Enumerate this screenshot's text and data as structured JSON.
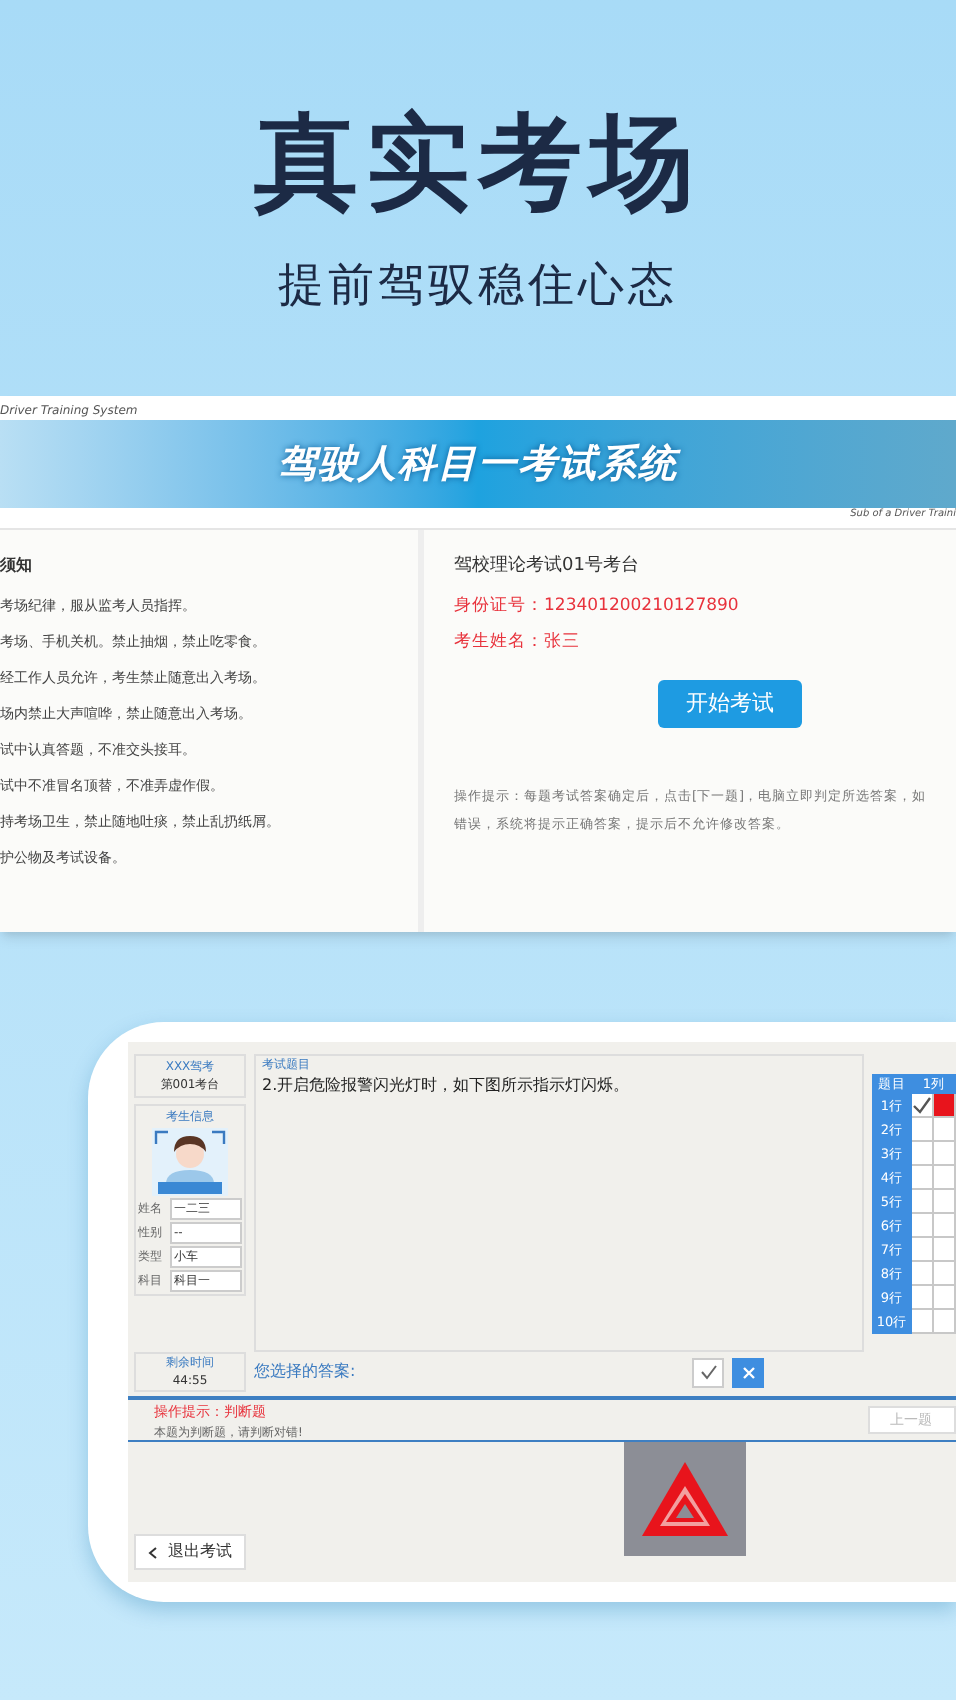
{
  "headline": {
    "title": "真实考场",
    "subtitle": "提前驾驭稳住心态"
  },
  "login_screen": {
    "top_caption": "Driver Training System",
    "banner_title": "驾驶人科目一考试系统",
    "banner_caption": "Sub of a Driver Traini",
    "notice": {
      "title": "须知",
      "lines": [
        "考场纪律，服从监考人员指挥。",
        "考场、手机关机。禁止抽烟，禁止吃零食。",
        "经工作人员允许，考生禁止随意出入考场。",
        "场内禁止大声喧哗，禁止随意出入考场。",
        "试中认真答题，不准交头接耳。",
        "试中不准冒名顶替，不准弄虚作假。",
        "持考场卫生，禁止随地吐痰，禁止乱扔纸屑。",
        "护公物及考试设备。"
      ]
    },
    "station": "驾校理论考试01号考台",
    "id_line": "身份证号：123401200210127890",
    "name_line": "考生姓名：张三",
    "start_button": "开始考试",
    "hint": "操作提示：每题考试答案确定后，点击[下一题]，电脑立即判定所选答案，如",
    "hint_line2": "错误，系统将提示正确答案，提示后不允许修改答案。"
  },
  "exam_screen": {
    "school": "XXX驾考",
    "seat": "第001考台",
    "info_title": "考生信息",
    "fields": [
      {
        "label": "姓名",
        "value": "一二三"
      },
      {
        "label": "性别",
        "value": "--"
      },
      {
        "label": "类型",
        "value": "小车"
      },
      {
        "label": "科目",
        "value": "科目一"
      }
    ],
    "time_label": "剩余时间",
    "time": "44:55",
    "question_title": "考试题目",
    "question": "2.开启危险报警闪光灯时，如下图所示指示灯闪烁。",
    "answer_label": "您选择的答案:",
    "tip_title": "操作提示：判断题",
    "tip_text": "本题为判断题，请判断对错!",
    "prev_button": "上一题",
    "exit_button": "退出考试",
    "grid": {
      "columns": [
        "题目",
        "1列"
      ],
      "rows": [
        {
          "label": "1行",
          "cells": [
            {
              "kind": "check"
            },
            {
              "kind": "wrong"
            }
          ]
        },
        {
          "label": "2行",
          "cells": [
            {
              "kind": "empty"
            },
            {
              "kind": "empty"
            }
          ]
        },
        {
          "label": "3行",
          "cells": [
            {
              "kind": "empty"
            },
            {
              "kind": "empty"
            }
          ]
        },
        {
          "label": "4行",
          "cells": [
            {
              "kind": "empty"
            },
            {
              "kind": "empty"
            }
          ]
        },
        {
          "label": "5行",
          "cells": [
            {
              "kind": "empty"
            },
            {
              "kind": "empty"
            }
          ]
        },
        {
          "label": "6行",
          "cells": [
            {
              "kind": "empty"
            },
            {
              "kind": "empty"
            }
          ]
        },
        {
          "label": "7行",
          "cells": [
            {
              "kind": "empty"
            },
            {
              "kind": "empty"
            }
          ]
        },
        {
          "label": "8行",
          "cells": [
            {
              "kind": "empty"
            },
            {
              "kind": "empty"
            }
          ]
        },
        {
          "label": "9行",
          "cells": [
            {
              "kind": "empty"
            },
            {
              "kind": "empty"
            }
          ]
        },
        {
          "label": "10行",
          "cells": [
            {
              "kind": "empty"
            },
            {
              "kind": "empty"
            }
          ]
        }
      ]
    }
  }
}
